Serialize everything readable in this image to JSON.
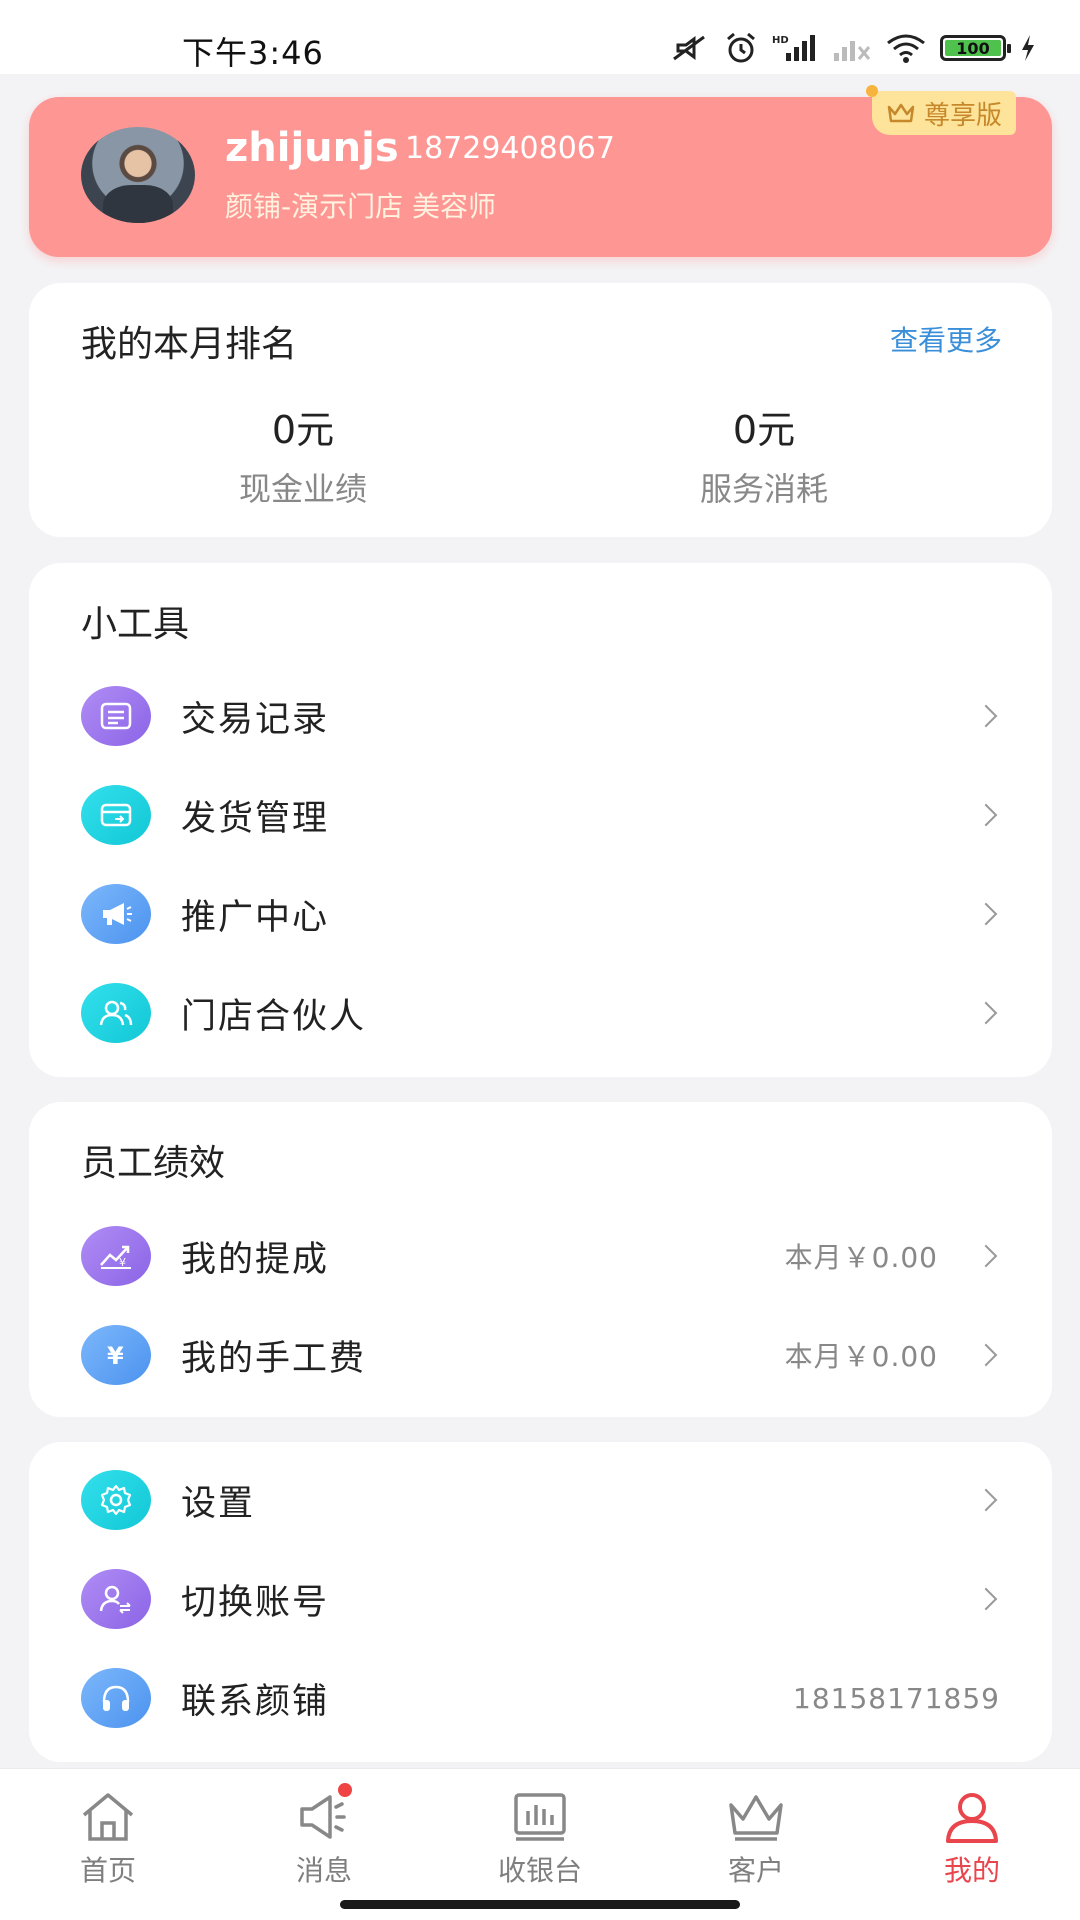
{
  "status_bar": {
    "time": "下午3:46",
    "battery": "100",
    "network": "HD"
  },
  "profile": {
    "name": "zhijunjs",
    "phone": "18729408067",
    "store_role": "颜铺-演示门店 美容师",
    "vip_badge": "尊享版"
  },
  "ranking": {
    "title": "我的本月排名",
    "more": "查看更多",
    "stats": [
      {
        "value": "0元",
        "label": "现金业绩"
      },
      {
        "value": "0元",
        "label": "服务消耗"
      }
    ]
  },
  "tools": {
    "title": "小工具",
    "items": [
      {
        "label": "交易记录",
        "icon": "receipt-icon"
      },
      {
        "label": "发货管理",
        "icon": "shipping-box-icon"
      },
      {
        "label": "推广中心",
        "icon": "megaphone-icon"
      },
      {
        "label": "门店合伙人",
        "icon": "partners-icon"
      }
    ]
  },
  "performance": {
    "title": "员工绩效",
    "items": [
      {
        "label": "我的提成",
        "value": "本月￥0.00",
        "icon": "commission-chart-icon"
      },
      {
        "label": "我的手工费",
        "value": "本月￥0.00",
        "icon": "yen-icon"
      }
    ]
  },
  "settings": {
    "items": [
      {
        "label": "设置",
        "icon": "gear-icon"
      },
      {
        "label": "切换账号",
        "icon": "switch-account-icon"
      },
      {
        "label": "联系颜铺",
        "value": "18158171859",
        "icon": "headset-icon"
      }
    ]
  },
  "tabbar": {
    "tabs": [
      {
        "label": "首页",
        "icon": "home-icon"
      },
      {
        "label": "消息",
        "icon": "megaphone-outline-icon"
      },
      {
        "label": "收银台",
        "icon": "cashier-icon"
      },
      {
        "label": "客户",
        "icon": "crown-icon"
      },
      {
        "label": "我的",
        "icon": "person-icon",
        "active": true
      }
    ]
  },
  "colors": {
    "profile_bg": "#fe9694",
    "accent_red": "#e8454c",
    "link_blue": "#3b8fd9",
    "badge_gold": "#fde49a"
  }
}
